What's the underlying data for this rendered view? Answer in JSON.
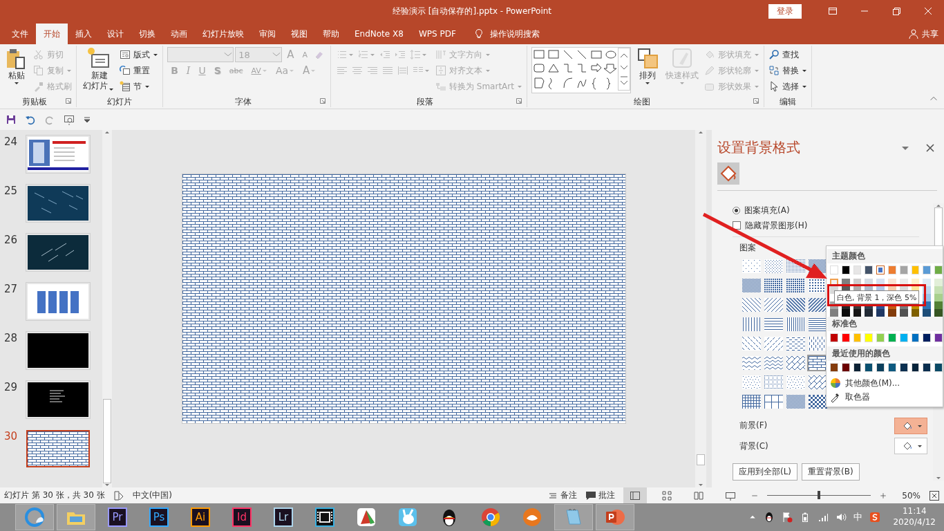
{
  "window": {
    "title": "经验演示 [自动保存的].pptx - PowerPoint",
    "sign_in": "登录"
  },
  "tabs": [
    {
      "label": "文件",
      "selected": false
    },
    {
      "label": "开始",
      "selected": true
    },
    {
      "label": "插入",
      "selected": false
    },
    {
      "label": "设计",
      "selected": false
    },
    {
      "label": "切换",
      "selected": false
    },
    {
      "label": "动画",
      "selected": false
    },
    {
      "label": "幻灯片放映",
      "selected": false
    },
    {
      "label": "审阅",
      "selected": false
    },
    {
      "label": "视图",
      "selected": false
    },
    {
      "label": "帮助",
      "selected": false
    },
    {
      "label": "EndNote X8",
      "selected": false
    },
    {
      "label": "WPS PDF",
      "selected": false
    }
  ],
  "tell_me": "操作说明搜索",
  "share": "共享",
  "ribbon": {
    "groups": [
      {
        "label": "剪贴板",
        "launcher": true,
        "sections": [
          {
            "lines": [
              {
                "items": [
                  {
                    "kind": "large",
                    "label": "粘贴",
                    "disabled": false,
                    "dropdown": true
                  }
                ]
              }
            ]
          },
          {
            "lines": [
              {
                "items": [
                  {
                    "kind": "small",
                    "label": "剪切",
                    "disabled": true,
                    "dropdown": false
                  }
                ]
              },
              {
                "items": [
                  {
                    "kind": "small",
                    "label": "复制",
                    "disabled": true,
                    "dropdown": true
                  }
                ]
              },
              {
                "items": [
                  {
                    "kind": "small",
                    "label": "格式刷",
                    "disabled": true,
                    "dropdown": false
                  }
                ]
              }
            ]
          }
        ]
      },
      {
        "label": "幻灯片",
        "launcher": false,
        "sections": [
          {
            "lines": [
              {
                "items": [
                  {
                    "kind": "large",
                    "label": "新建幻灯片",
                    "disabled": false,
                    "dropdown": true
                  }
                ]
              }
            ]
          },
          {
            "lines": [
              {
                "items": [
                  {
                    "kind": "small",
                    "label": "版式",
                    "disabled": false,
                    "dropdown": true
                  }
                ]
              },
              {
                "items": [
                  {
                    "kind": "small",
                    "label": "重置",
                    "disabled": false,
                    "dropdown": false
                  }
                ]
              },
              {
                "items": [
                  {
                    "kind": "small",
                    "label": "节",
                    "disabled": false,
                    "dropdown": true
                  }
                ]
              }
            ]
          }
        ]
      },
      {
        "label": "字体",
        "launcher": true,
        "sections": [
          {
            "lines": [
              {
                "items": [
                  {
                    "kind": "combo",
                    "disabled": true
                  },
                  {
                    "kind": "combo",
                    "value": "18",
                    "disabled": true
                  },
                  {
                    "kind": "glyph",
                    "label": "A",
                    "disabled": true,
                    "dropdown": false
                  },
                  {
                    "kind": "glyph",
                    "label": "A",
                    "disabled": true,
                    "dropdown": false
                  },
                  {
                    "kind": "icon",
                    "disabled": true,
                    "dropdown": false
                  }
                ]
              },
              {
                "items": [
                  {
                    "kind": "glyph",
                    "label": "B",
                    "disabled": true,
                    "dropdown": false
                  },
                  {
                    "kind": "glyph",
                    "label": "I",
                    "disabled": true,
                    "dropdown": false
                  },
                  {
                    "kind": "glyph",
                    "label": "U",
                    "disabled": true,
                    "dropdown": false
                  },
                  {
                    "kind": "glyph",
                    "label": "S",
                    "disabled": true,
                    "dropdown": false
                  },
                  {
                    "kind": "glyph",
                    "label": "abc",
                    "disabled": true,
                    "dropdown": false
                  },
                  {
                    "kind": "glyph",
                    "label": "AV",
                    "disabled": true,
                    "dropdown": true
                  },
                  {
                    "kind": "glyph",
                    "label": "Aa",
                    "disabled": true,
                    "dropdown": true
                  },
                  {
                    "kind": "glyph",
                    "label": "A",
                    "disabled": true,
                    "dropdown": true
                  }
                ]
              }
            ]
          }
        ]
      },
      {
        "label": "段落",
        "launcher": true,
        "sections": [
          {
            "lines": [
              {
                "items": [
                  {
                    "kind": "icon",
                    "disabled": true,
                    "dropdown": true
                  },
                  {
                    "kind": "icon",
                    "disabled": true,
                    "dropdown": true
                  },
                  {
                    "kind": "icon",
                    "disabled": true,
                    "dropdown": false
                  },
                  {
                    "kind": "icon",
                    "disabled": true,
                    "dropdown": false
                  },
                  {
                    "kind": "icon",
                    "disabled": true,
                    "dropdown": true
                  }
                ]
              },
              {
                "items": [
                  {
                    "kind": "icon",
                    "disabled": true,
                    "dropdown": false
                  },
                  {
                    "kind": "icon",
                    "disabled": true,
                    "dropdown": false
                  },
                  {
                    "kind": "icon",
                    "disabled": true,
                    "dropdown": false
                  },
                  {
                    "kind": "icon",
                    "disabled": true,
                    "dropdown": false
                  },
                  {
                    "kind": "icon",
                    "disabled": true,
                    "dropdown": false
                  },
                  {
                    "kind": "icon",
                    "disabled": true,
                    "dropdown": true
                  }
                ]
              }
            ]
          },
          {
            "lines": [
              {
                "items": [
                  {
                    "kind": "small",
                    "label": "文字方向",
                    "disabled": true,
                    "dropdown": true
                  }
                ]
              },
              {
                "items": [
                  {
                    "kind": "small",
                    "label": "对齐文本",
                    "disabled": true,
                    "dropdown": true
                  }
                ]
              },
              {
                "items": [
                  {
                    "kind": "small",
                    "label": "转换为 SmartArt",
                    "disabled": true,
                    "dropdown": true
                  }
                ]
              }
            ]
          }
        ]
      },
      {
        "label": "绘图",
        "launcher": true,
        "sections": [
          {
            "lines": [
              {
                "items": [
                  {
                    "kind": "gallery"
                  }
                ]
              }
            ]
          },
          {
            "lines": [
              {
                "items": [
                  {
                    "kind": "large",
                    "label": "排列",
                    "disabled": false,
                    "dropdown": true
                  }
                ]
              }
            ]
          },
          {
            "lines": [
              {
                "items": [
                  {
                    "kind": "large",
                    "label": "快速样式",
                    "disabled": true,
                    "dropdown": true
                  }
                ]
              }
            ]
          },
          {
            "lines": [
              {
                "items": [
                  {
                    "kind": "small",
                    "label": "形状填充",
                    "disabled": true,
                    "dropdown": true
                  }
                ]
              },
              {
                "items": [
                  {
                    "kind": "small",
                    "label": "形状轮廓",
                    "disabled": true,
                    "dropdown": true
                  }
                ]
              },
              {
                "items": [
                  {
                    "kind": "small",
                    "label": "形状效果",
                    "disabled": true,
                    "dropdown": true
                  }
                ]
              }
            ]
          }
        ]
      },
      {
        "label": "编辑",
        "launcher": false,
        "sections": [
          {
            "lines": [
              {
                "items": [
                  {
                    "kind": "small",
                    "label": "查找",
                    "disabled": false,
                    "dropdown": false
                  }
                ]
              },
              {
                "items": [
                  {
                    "kind": "small",
                    "label": "替换",
                    "disabled": false,
                    "dropdown": true
                  }
                ]
              },
              {
                "items": [
                  {
                    "kind": "small",
                    "label": "选择",
                    "disabled": false,
                    "dropdown": true
                  }
                ]
              }
            ]
          }
        ]
      }
    ]
  },
  "slides": [
    {
      "number": "24",
      "kind": "photo-title",
      "selected": false
    },
    {
      "number": "25",
      "kind": "meteors-blue",
      "selected": false
    },
    {
      "number": "26",
      "kind": "meteors-dark",
      "selected": false
    },
    {
      "number": "27",
      "kind": "blue-columns",
      "selected": false
    },
    {
      "number": "28",
      "kind": "black",
      "selected": false
    },
    {
      "number": "29",
      "kind": "black-text",
      "selected": false
    },
    {
      "number": "30",
      "kind": "bricks",
      "selected": true
    }
  ],
  "format_pane": {
    "title": "设置背景格式",
    "options": [
      {
        "kind": "radio",
        "label": "图案填充(A)",
        "checked": true
      },
      {
        "kind": "checkbox",
        "label": "隐藏背景图形(H)",
        "checked": false
      }
    ],
    "pattern_label": "图案",
    "patterns": [
      {
        "kind": "dots-sparse",
        "selected": false
      },
      {
        "kind": "dots",
        "selected": false
      },
      {
        "kind": "dots-dense",
        "selected": false
      },
      {
        "kind": "checker-small",
        "selected": false
      },
      {
        "kind": "checker-small",
        "selected": false
      },
      {
        "kind": "dots-heavy",
        "selected": false
      },
      {
        "kind": "dots-heavy",
        "selected": false
      },
      {
        "kind": "dots-large",
        "selected": false
      },
      {
        "kind": "diag-down",
        "selected": false
      },
      {
        "kind": "diag-up",
        "selected": false
      },
      {
        "kind": "diag-down-thick",
        "selected": false
      },
      {
        "kind": "diag-up-thick",
        "selected": false
      },
      {
        "kind": "vertical",
        "selected": false
      },
      {
        "kind": "horizontal",
        "selected": false
      },
      {
        "kind": "vertical-dense",
        "selected": false
      },
      {
        "kind": "horizontal-dense",
        "selected": false
      },
      {
        "kind": "dash-down",
        "selected": false
      },
      {
        "kind": "dash-up",
        "selected": false
      },
      {
        "kind": "dash-horizontal",
        "selected": false
      },
      {
        "kind": "dash-vertical",
        "selected": false
      },
      {
        "kind": "wave",
        "selected": false
      },
      {
        "kind": "zigzag",
        "selected": false
      },
      {
        "kind": "diag-bricks",
        "selected": false
      },
      {
        "kind": "bricks",
        "selected": true
      },
      {
        "kind": "confetti",
        "selected": false
      },
      {
        "kind": "dotted-grid",
        "selected": false
      },
      {
        "kind": "confetti",
        "selected": false
      },
      {
        "kind": "weave",
        "selected": false
      },
      {
        "kind": "grid",
        "selected": false
      },
      {
        "kind": "large-grid",
        "selected": false
      },
      {
        "kind": "checker-small",
        "selected": false
      },
      {
        "kind": "checker-large",
        "selected": false
      }
    ],
    "colors": [
      {
        "label": "前景(F)",
        "active": true
      },
      {
        "label": "背景(C)",
        "active": false
      }
    ],
    "buttons": [
      "应用到全部(L)",
      "重置背景(B)"
    ]
  },
  "color_menu": {
    "theme_title": "主题颜色",
    "theme_colors": [
      [
        {
          "color": "#ffffff",
          "selected": false,
          "hovered": false
        },
        {
          "color": "#000000",
          "selected": false,
          "hovered": false
        },
        {
          "color": "#e7e6e6",
          "selected": false,
          "hovered": false
        },
        {
          "color": "#44546a",
          "selected": false,
          "hovered": false
        },
        {
          "color": "#4472c4",
          "selected": true,
          "hovered": false
        },
        {
          "color": "#ed7d31",
          "selected": false,
          "hovered": false
        },
        {
          "color": "#a5a5a5",
          "selected": false,
          "hovered": false
        },
        {
          "color": "#ffc000",
          "selected": false,
          "hovered": false
        },
        {
          "color": "#5b9bd5",
          "selected": false,
          "hovered": false
        },
        {
          "color": "#70ad47",
          "selected": false,
          "hovered": false
        }
      ],
      [
        {
          "color": "#f2f2f2",
          "selected": false,
          "hovered": true
        },
        {
          "color": "#7f7f7f",
          "selected": false,
          "hovered": false
        },
        {
          "color": "#d0cece",
          "selected": false,
          "hovered": false
        },
        {
          "color": "#d6dce4",
          "selected": false,
          "hovered": false
        },
        {
          "color": "#d9e2f3",
          "selected": false,
          "hovered": false
        },
        {
          "color": "#fbe5d5",
          "selected": false,
          "hovered": false
        },
        {
          "color": "#ededed",
          "selected": false,
          "hovered": false
        },
        {
          "color": "#fff2cc",
          "selected": false,
          "hovered": false
        },
        {
          "color": "#deebf6",
          "selected": false,
          "hovered": false
        },
        {
          "color": "#e2efd9",
          "selected": false,
          "hovered": false
        }
      ],
      [
        {
          "color": "#d8d8d8",
          "selected": false,
          "hovered": false
        },
        {
          "color": "#595959",
          "selected": false,
          "hovered": false
        },
        {
          "color": "#aeabab",
          "selected": false,
          "hovered": false
        },
        {
          "color": "#adb9ca",
          "selected": false,
          "hovered": false
        },
        {
          "color": "#b4c6e7",
          "selected": false,
          "hovered": false
        },
        {
          "color": "#f7cbac",
          "selected": false,
          "hovered": false
        },
        {
          "color": "#dbdbdb",
          "selected": false,
          "hovered": false
        },
        {
          "color": "#fee599",
          "selected": false,
          "hovered": false
        },
        {
          "color": "#bdd7ee",
          "selected": false,
          "hovered": false
        },
        {
          "color": "#c5e0b3",
          "selected": false,
          "hovered": false
        }
      ],
      [
        {
          "color": "#9cc3e5",
          "selected": false,
          "hovered": false
        },
        {
          "color": "#a8d08d",
          "selected": false,
          "hovered": false
        }
      ],
      [
        {
          "color": "#a5a5a5",
          "selected": false,
          "hovered": false
        },
        {
          "color": "#262626",
          "selected": false,
          "hovered": false
        },
        {
          "color": "#3a3838",
          "selected": false,
          "hovered": false
        },
        {
          "color": "#323f4f",
          "selected": false,
          "hovered": false
        },
        {
          "color": "#2f5496",
          "selected": false,
          "hovered": false
        },
        {
          "color": "#c55a11",
          "selected": false,
          "hovered": false
        },
        {
          "color": "#7b7b7b",
          "selected": false,
          "hovered": false
        },
        {
          "color": "#bf9000",
          "selected": false,
          "hovered": false
        },
        {
          "color": "#2e75b5",
          "selected": false,
          "hovered": false
        },
        {
          "color": "#538135",
          "selected": false,
          "hovered": false
        }
      ],
      [
        {
          "color": "#7f7f7f",
          "selected": false,
          "hovered": false
        },
        {
          "color": "#0c0c0c",
          "selected": false,
          "hovered": false
        },
        {
          "color": "#171616",
          "selected": false,
          "hovered": false
        },
        {
          "color": "#222a35",
          "selected": false,
          "hovered": false
        },
        {
          "color": "#1f3864",
          "selected": false,
          "hovered": false
        },
        {
          "color": "#833c0b",
          "selected": false,
          "hovered": false
        },
        {
          "color": "#525252",
          "selected": false,
          "hovered": false
        },
        {
          "color": "#7f6000",
          "selected": false,
          "hovered": false
        },
        {
          "color": "#1e4e79",
          "selected": false,
          "hovered": false
        },
        {
          "color": "#375623",
          "selected": false,
          "hovered": false
        }
      ]
    ],
    "tooltip": "白色, 背景 1，深色 5%",
    "standard_title": "标准色",
    "standard_colors": [
      {
        "color": "#c00000"
      },
      {
        "color": "#ff0000"
      },
      {
        "color": "#ffc000"
      },
      {
        "color": "#ffff00"
      },
      {
        "color": "#92d050"
      },
      {
        "color": "#00b050"
      },
      {
        "color": "#00b0f0"
      },
      {
        "color": "#0070c0"
      },
      {
        "color": "#002060"
      },
      {
        "color": "#7030a0"
      }
    ],
    "recent_title": "最近使用的颜色",
    "recent_colors": [
      {
        "color": "#843c0c"
      },
      {
        "color": "#6b0000"
      },
      {
        "color": "#0d2235"
      },
      {
        "color": "#0a5070"
      },
      {
        "color": "#0b3f5c"
      },
      {
        "color": "#0e5a80"
      },
      {
        "color": "#0b3050"
      },
      {
        "color": "#07243b"
      },
      {
        "color": "#0b2f4f"
      },
      {
        "color": "#0b4a66"
      }
    ],
    "items": [
      {
        "kind": "more-colors",
        "label": "其他颜色(M)..."
      },
      {
        "kind": "eyedropper",
        "label": "取色器"
      }
    ]
  },
  "status_bar": {
    "slide_info": "幻灯片 第 30 张，共 30 张",
    "language": "中文(中国)",
    "notes": "备注",
    "comments": "批注",
    "views": [
      {
        "selected": true
      },
      {
        "selected": false
      },
      {
        "selected": false
      },
      {
        "selected": false
      }
    ],
    "zoom": {
      "level": 0.5
    },
    "zoom_text": "50%"
  },
  "taskbar": {
    "apps": [
      {
        "kind": "browser",
        "running": true
      },
      {
        "kind": "folder",
        "running": true
      },
      {
        "kind": "letter",
        "label": "Pr",
        "color": "#9999ff",
        "running": false
      },
      {
        "kind": "letter",
        "label": "Ps",
        "color": "#31a8ff",
        "running": false
      },
      {
        "kind": "letter",
        "label": "Ai",
        "color": "#ff9a00",
        "running": false
      },
      {
        "kind": "letter",
        "label": "Id",
        "color": "#ff3366",
        "running": false
      },
      {
        "kind": "letter",
        "label": "Lr",
        "color": "#add5ec",
        "running": false
      },
      {
        "kind": "film",
        "running": false
      },
      {
        "kind": "wedge",
        "running": false
      },
      {
        "kind": "bunny",
        "running": false
      },
      {
        "kind": "penguin",
        "running": false
      },
      {
        "kind": "chrome",
        "running": false
      },
      {
        "kind": "fox",
        "running": false
      },
      {
        "kind": "notepad",
        "running": true
      },
      {
        "kind": "powerpoint",
        "running": true
      }
    ],
    "ime": "中",
    "time": "11:14",
    "date": "2020/4/12"
  }
}
